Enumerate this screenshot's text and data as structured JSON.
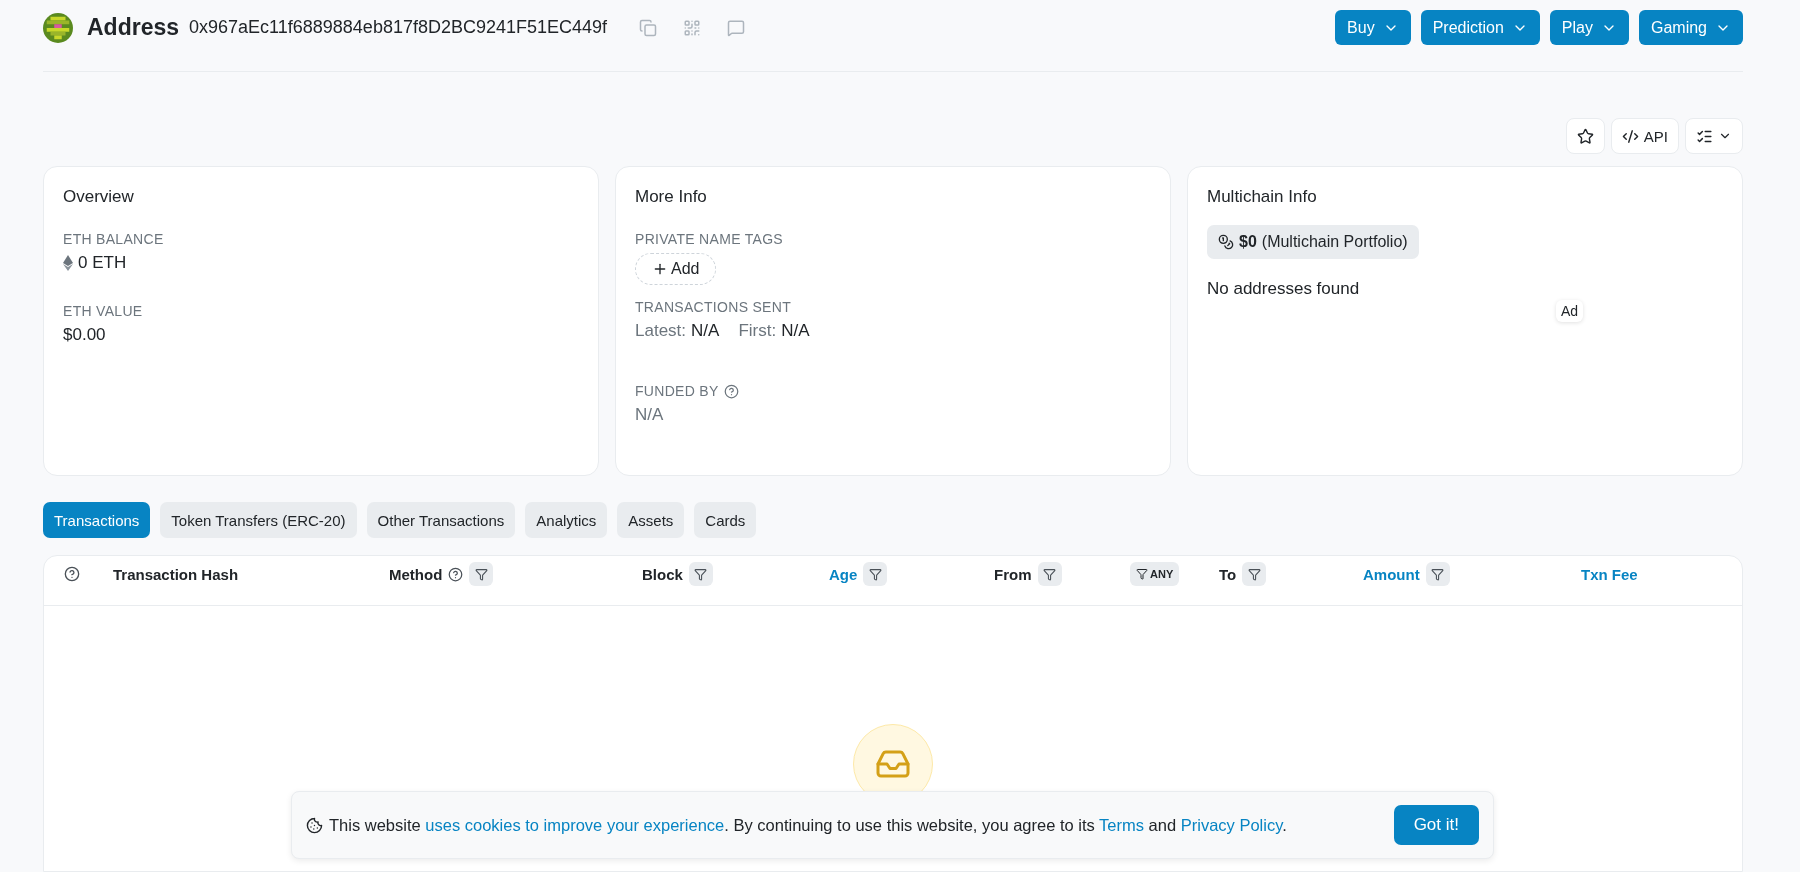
{
  "header": {
    "title": "Address",
    "address": "0x967aEc11f6889884eb817f8D2BC9241F51EC449f",
    "menus": [
      {
        "label": "Buy"
      },
      {
        "label": "Prediction"
      },
      {
        "label": "Play"
      },
      {
        "label": "Gaming"
      }
    ]
  },
  "toolbar": {
    "api_label": "API"
  },
  "overview": {
    "title": "Overview",
    "fields": [
      {
        "label": "ETH BALANCE",
        "value": "0 ETH",
        "kind": "eth"
      },
      {
        "label": "ETH VALUE",
        "value": "$0.00",
        "kind": "plain"
      }
    ]
  },
  "more_info": {
    "title": "More Info",
    "tags_label": "PRIVATE NAME TAGS",
    "add_label": "Add",
    "sent_label": "TRANSACTIONS SENT",
    "latest_label": "Latest:",
    "latest_value": "N/A",
    "first_label": "First:",
    "first_value": "N/A",
    "funded_label": "FUNDED BY",
    "funded_value": "N/A"
  },
  "multichain": {
    "title": "Multichain Info",
    "portfolio_value": "$0",
    "portfolio_label": "(Multichain Portfolio)",
    "empty": "No addresses found",
    "ad": "Ad"
  },
  "tabs": [
    {
      "label": "Transactions",
      "selected": true
    },
    {
      "label": "Token Transfers (ERC-20)",
      "selected": false
    },
    {
      "label": "Other Transactions",
      "selected": false
    },
    {
      "label": "Analytics",
      "selected": false
    },
    {
      "label": "Assets",
      "selected": false
    },
    {
      "label": "Cards",
      "selected": false
    }
  ],
  "table": {
    "columns": [
      {
        "kind": "header",
        "label": "Transaction Hash",
        "link": false,
        "help": false,
        "filter": false
      },
      {
        "kind": "header",
        "label": "Method",
        "link": false,
        "help": true,
        "filter": true
      },
      {
        "kind": "header",
        "label": "Block",
        "link": false,
        "help": false,
        "filter": true
      },
      {
        "kind": "header",
        "label": "Age",
        "link": true,
        "help": false,
        "filter": true
      },
      {
        "kind": "header",
        "label": "From",
        "link": false,
        "help": false,
        "filter": true
      },
      {
        "kind": "chip",
        "label": "ANY",
        "filter": true
      },
      {
        "kind": "header",
        "label": "To",
        "link": false,
        "help": false,
        "filter": true
      },
      {
        "kind": "header",
        "label": "Amount",
        "link": true,
        "help": false,
        "filter": true
      },
      {
        "kind": "header",
        "label": "Txn Fee",
        "link": true,
        "help": false,
        "filter": false
      }
    ]
  },
  "cookie_banner": {
    "parts": [
      {
        "kind": "text",
        "text": "This website "
      },
      {
        "kind": "link",
        "text": "uses cookies to improve your experience"
      },
      {
        "kind": "text",
        "text": ". By continuing to use this website, you agree to its "
      },
      {
        "kind": "link",
        "text": "Terms"
      },
      {
        "kind": "text",
        "text": " and "
      },
      {
        "kind": "link",
        "text": "Privacy Policy"
      },
      {
        "kind": "text",
        "text": "."
      }
    ],
    "button": "Got it!"
  }
}
